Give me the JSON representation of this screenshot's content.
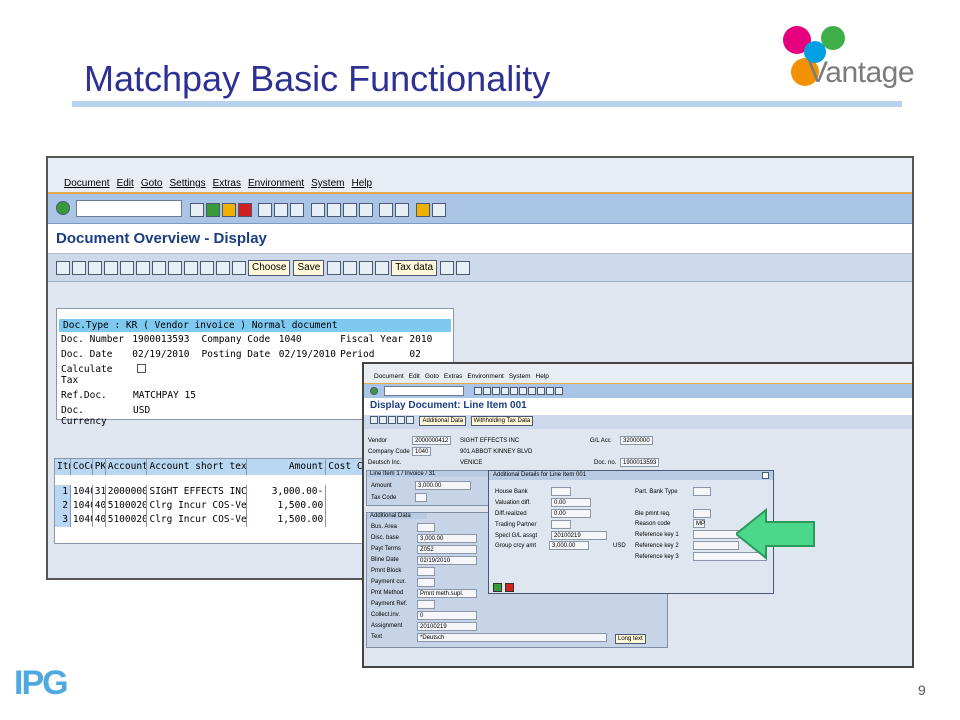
{
  "slide": {
    "title": "Matchpay Basic Functionality",
    "page_number": "9",
    "brand_name": "Vantage",
    "footer_logo": "IPG",
    "accent_color": "#2e3192"
  },
  "window1": {
    "menu": [
      "Document",
      "Edit",
      "Goto",
      "Settings",
      "Extras",
      "Environment",
      "System",
      "Help"
    ],
    "title": "Document Overview - Display",
    "toolbar": {
      "choose": "Choose",
      "save": "Save",
      "tax_data": "Tax data"
    },
    "header": {
      "doc_type": "Doc.Type : KR ( Vendor invoice ) Normal document",
      "rows": [
        [
          "Doc. Number",
          "1900013593",
          "Company Code",
          "1040",
          "Fiscal Year",
          "2010"
        ],
        [
          "Doc. Date",
          "02/19/2010",
          "Posting Date",
          "02/19/2010",
          "Period",
          "02"
        ]
      ],
      "calc_tax": "Calculate Tax",
      "ref_doc_label": "Ref.Doc.",
      "ref_doc": "MATCHPAY 15",
      "currency_label": "Doc. Currency",
      "currency": "USD"
    },
    "items": {
      "columns": [
        "Itm",
        "CoCd",
        "PK",
        "Account",
        "Account short text",
        "Amount",
        "Cost C"
      ],
      "rows": [
        [
          "1",
          "1040",
          "31",
          "2000000…",
          "SIGHT EFFECTS INC",
          "3,000.00-"
        ],
        [
          "2",
          "1040",
          "40",
          "51000200",
          "Clrg Incur COS-Vend",
          "1,500.00"
        ],
        [
          "3",
          "1040",
          "40",
          "51000200",
          "Clrg Incur COS-Vend",
          "1,500.00"
        ]
      ]
    }
  },
  "window2": {
    "menu": [
      "Document",
      "Edit",
      "Goto",
      "Extras",
      "Environment",
      "System",
      "Help"
    ],
    "title": "Display Document: Line Item 001",
    "toolbar": {
      "additional_data": "Additional Data",
      "withholding": "Withholding Tax Data"
    },
    "vendor_label": "Vendor",
    "vendor": "2000000412",
    "vendor_name": "SIGHT EFFECTS INC",
    "gl_label": "G/L Acc",
    "gl": "32000000",
    "company_label": "Company Code",
    "company": "1040",
    "address": "901 ABBOT KINNEY BLVD",
    "company_name": "Deutsch Inc.",
    "city": "VENICE",
    "docno_label": "Doc. no.",
    "docno": "1900013593",
    "line_item_title": "Line Item 1 / Invoice / 31",
    "amount_label": "Amount",
    "amount": "3,000.00",
    "tax_code_label": "Tax Code",
    "additional_data_title": "Additional Data",
    "fields": [
      {
        "label": "Bus. Area",
        "value": ""
      },
      {
        "label": "Disc. base",
        "value": "3,000.00"
      },
      {
        "label": "Payt Terms",
        "value": "Z052"
      },
      {
        "label": "Bline Date",
        "value": "02/19/2010"
      },
      {
        "label": "Pmnt Block",
        "value": ""
      },
      {
        "label": "Payment cur.",
        "value": ""
      },
      {
        "label": "Pmt Method",
        "value": "Pmnt meth.supl."
      },
      {
        "label": "Payment Ref.",
        "value": ""
      },
      {
        "label": "Collect.inv.",
        "value": "0"
      },
      {
        "label": "Assignment",
        "value": "20100219"
      },
      {
        "label": "Text",
        "value": "*Deutsch"
      }
    ],
    "long_text": "Long text",
    "popup": {
      "title": "Additional Details for Line Item 001",
      "left": [
        {
          "label": "House Bank",
          "value": ""
        },
        {
          "label": "Valuation diff.",
          "value": "0.00"
        },
        {
          "label": "Diff.realized",
          "value": "0.00"
        },
        {
          "label": "Trading Partner",
          "value": ""
        },
        {
          "label": "Specl G/L assgt",
          "value": "20100219"
        },
        {
          "label": "Group crcy amt",
          "value": "3,000.00"
        }
      ],
      "currency": "USD",
      "right": [
        {
          "label": "Part. Bank Type",
          "value": ""
        },
        {
          "label": "Ble pmnt req.",
          "value": ""
        },
        {
          "label": "Reason code",
          "value": "MP"
        },
        {
          "label": "Reference key 1",
          "value": ""
        },
        {
          "label": "Reference key 2",
          "value": ""
        },
        {
          "label": "Reference key 3",
          "value": ""
        }
      ]
    }
  }
}
